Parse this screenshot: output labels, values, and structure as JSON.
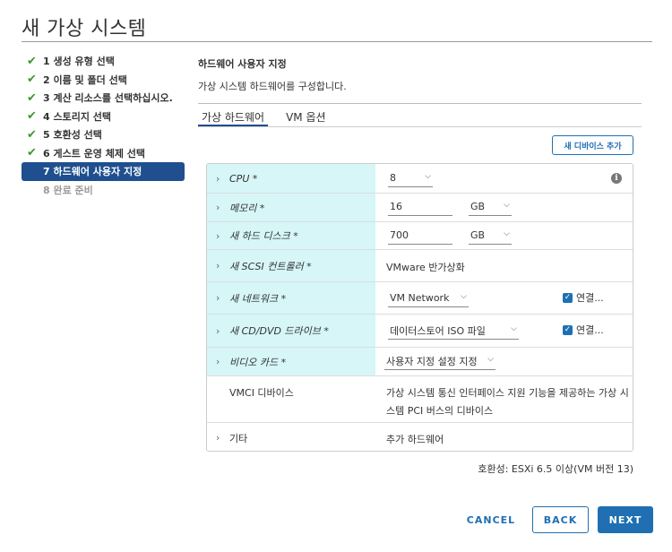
{
  "window": {
    "title": "새 가상 시스템"
  },
  "nav": {
    "items": [
      {
        "label": "1 생성 유형 선택",
        "state": "done"
      },
      {
        "label": "2 이름 및 폴더 선택",
        "state": "done"
      },
      {
        "label": "3 계산 리소스를 선택하십시오.",
        "state": "done"
      },
      {
        "label": "4 스토리지 선택",
        "state": "done"
      },
      {
        "label": "5 호환성 선택",
        "state": "done"
      },
      {
        "label": "6 게스트 운영 체제 선택",
        "state": "done"
      },
      {
        "label": "7 하드웨어 사용자 지정",
        "state": "active"
      },
      {
        "label": "8 완료 준비",
        "state": "disabled"
      }
    ]
  },
  "section": {
    "title": "하드웨어 사용자 지정",
    "description": "가상 시스템 하드웨어를 구성합니다."
  },
  "tabs": [
    {
      "label": "가상 하드웨어",
      "active": true
    },
    {
      "label": "VM 옵션",
      "active": false
    }
  ],
  "add_device_label": "새 디바이스 추가",
  "hardware": {
    "cpu": {
      "label": "CPU *",
      "value": "8"
    },
    "memory": {
      "label": "메모리 *",
      "value": "16",
      "unit": "GB"
    },
    "disk": {
      "label": "새 하드 디스크 *",
      "value": "700",
      "unit": "GB"
    },
    "scsi": {
      "label": "새 SCSI 컨트롤러 *",
      "value": "VMware 반가상화"
    },
    "network": {
      "label": "새 네트워크 *",
      "value": "VM Network",
      "connect_label": "연결..."
    },
    "cddvd": {
      "label": "새 CD/DVD 드라이브 *",
      "value": "데이터스토어 ISO 파일",
      "connect_label": "연결..."
    },
    "video": {
      "label": "비디오 카드 *",
      "value": "사용자 지정 설정 지정"
    },
    "vmci": {
      "label": "VMCI 디바이스",
      "desc_line1": "가상 시스템 통신 인터페이스 지원 기능을 제공하는 가상 시",
      "desc_line2": "스템 PCI 버스의 디바이스"
    },
    "other": {
      "label": "기타",
      "value": "추가 하드웨어"
    }
  },
  "compatibility": "호환성: ESXi 6.5 이상(VM 버전 13)",
  "buttons": {
    "cancel": "CANCEL",
    "back": "BACK",
    "next": "NEXT"
  },
  "colors": {
    "accent": "#1f6fb2",
    "nav_active": "#1f4f8e",
    "label_highlight": "#d6f6f8",
    "check": "#3c9a2b"
  }
}
